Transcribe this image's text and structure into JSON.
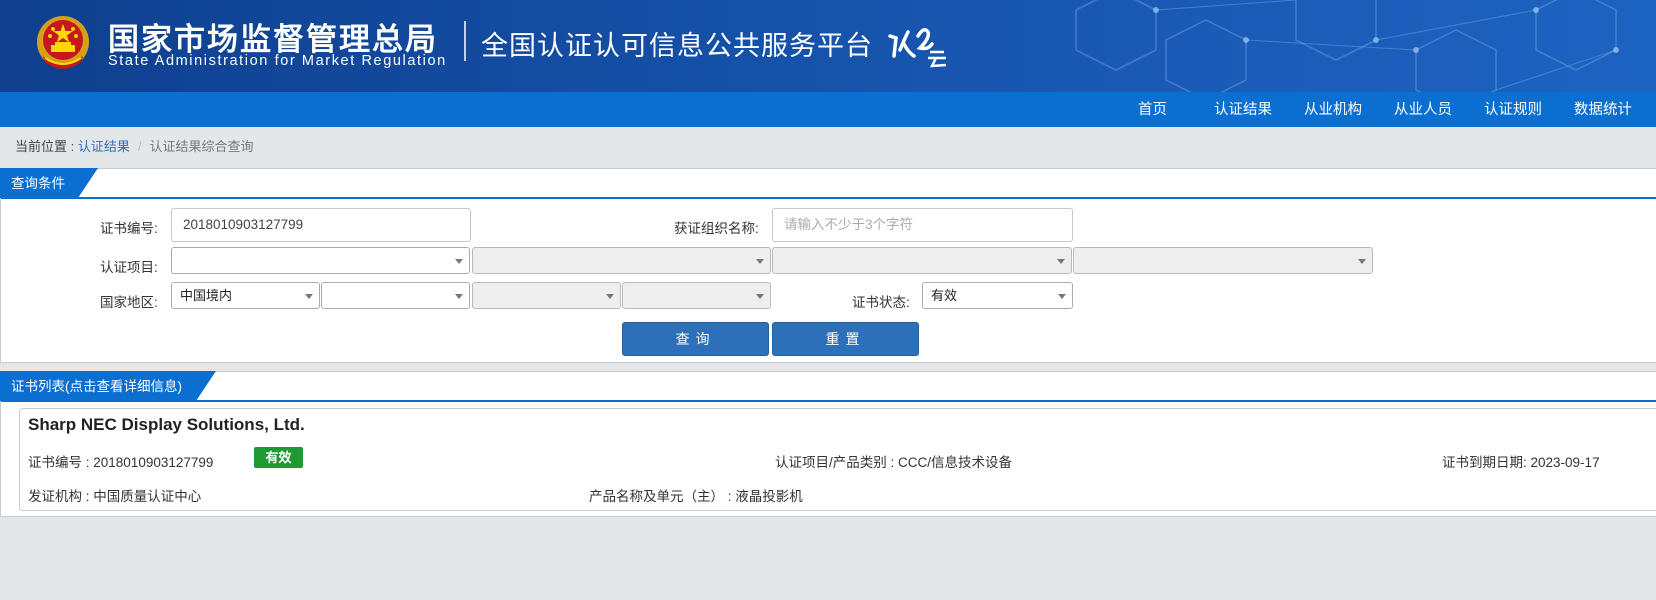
{
  "header": {
    "title_cn": "国家市场监督管理总局",
    "title_en": "State Administration  for  Market Regulation",
    "platform_name": "全国认证认可信息公共服务平台",
    "platform_logo_text": "认云"
  },
  "nav": {
    "items": [
      {
        "label": "首页"
      },
      {
        "label": "认证结果"
      },
      {
        "label": "从业机构"
      },
      {
        "label": "从业人员"
      },
      {
        "label": "认证规则"
      },
      {
        "label": "数据统计"
      }
    ]
  },
  "breadcrumb": {
    "prefix": "当前位置 : ",
    "link": "认证结果",
    "separator": "/",
    "current": "认证结果综合查询"
  },
  "query_panel": {
    "title": "查询条件",
    "cert_no_label": "证书编号:",
    "cert_no_value": "2018010903127799",
    "org_name_label": "获证组织名称:",
    "org_name_placeholder": "请输入不少于3个字符",
    "project_label": "认证项目:",
    "region_label": "国家地区:",
    "region_value": "中国境内",
    "status_label": "证书状态:",
    "status_value": "有效",
    "search_button": "查询",
    "reset_button": "重置"
  },
  "list_panel": {
    "title": "证书列表(点击查看详细信息)"
  },
  "result": {
    "company": "Sharp NEC Display Solutions, Ltd.",
    "cert_no_label": "证书编号 : ",
    "cert_no": "2018010903127799",
    "status": "有效",
    "project_label": "认证项目/产品类别 : ",
    "project": "CCC/信息技术设备",
    "expiry_label": "证书到期日期: ",
    "expiry": "2023-09-17",
    "issuer_label": "发证机构 : ",
    "issuer": "中国质量认证中心",
    "product_label": "产品名称及单元（主） : ",
    "product": "液晶投影机"
  },
  "colors": {
    "banner": "#1551a8",
    "nav": "#0a6fd1",
    "button": "#2d70b9",
    "status_valid": "#1e9a33",
    "link": "#2a6fbd"
  }
}
